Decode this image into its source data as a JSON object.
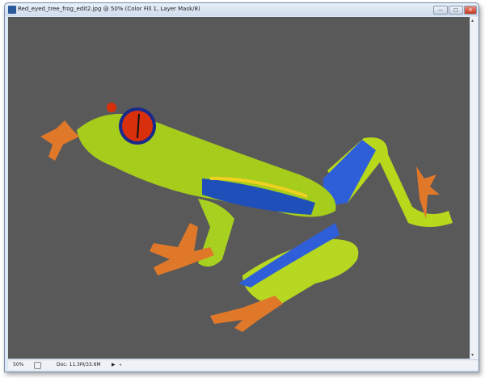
{
  "window": {
    "title": "Red_eyed_tree_frog_edit2.jpg @ 50% (Color Fill 1, Layer Mask/8)",
    "minimize": "—",
    "maximize": "□",
    "close": "✕"
  },
  "status": {
    "zoom": "50%",
    "doc": "Doc: 11.3M/33.6M",
    "menu_arrow": "▶",
    "scroll_left": "◂"
  },
  "scroll": {
    "up": "▴",
    "down": "▾"
  },
  "colors": {
    "canvas": "#595959",
    "frog_green": "#a8d020",
    "frog_blue": "#2a58d0",
    "eye_red": "#d8300c",
    "toes": "#e87a2a"
  }
}
